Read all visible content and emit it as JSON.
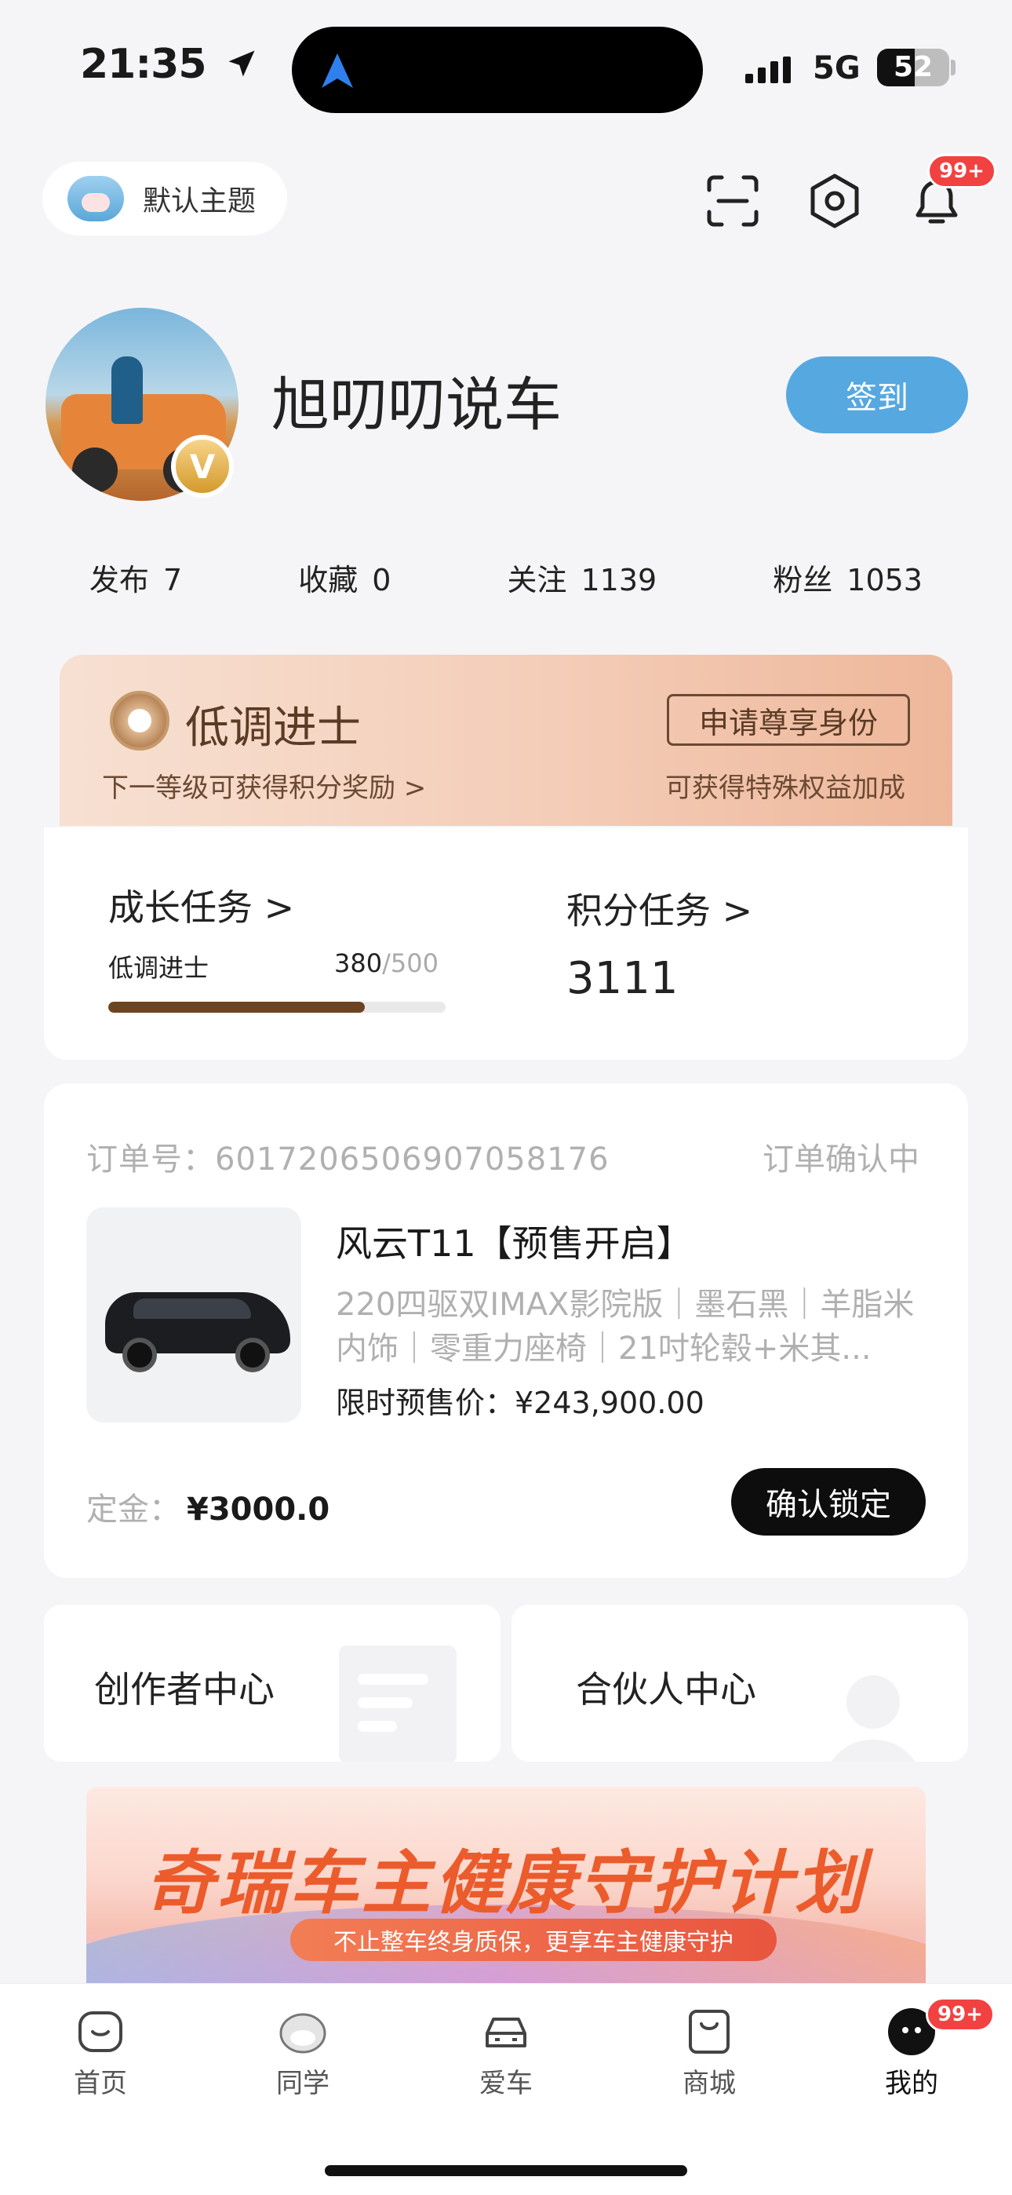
{
  "status_bar": {
    "time": "21:35",
    "network": "5G",
    "battery": "52",
    "battery_level": 0.52
  },
  "header": {
    "theme_label": "默认主题",
    "notification_badge": "99+"
  },
  "profile": {
    "username": "旭叨叨说车",
    "verified_mark": "V",
    "signin_label": "签到",
    "stats": [
      {
        "label": "发布",
        "value": "7"
      },
      {
        "label": "收藏",
        "value": "0"
      },
      {
        "label": "关注",
        "value": "1139"
      },
      {
        "label": "粉丝",
        "value": "1053"
      }
    ]
  },
  "level": {
    "title": "低调进士",
    "sub": "下一等级可获得积分奖励 >",
    "apply_label": "申请尊享身份",
    "apply_sub": "可获得特殊权益加成"
  },
  "tasks": {
    "growth_title": "成长任务 >",
    "growth_level": "低调进士",
    "growth_current": "380",
    "growth_total": "/500",
    "growth_progress": 0.76,
    "points_title": "积分任务 >",
    "points_value": "3111"
  },
  "order": {
    "number": "订单号：6017206506907058176",
    "status": "订单确认中",
    "product_title": "风云T11【预售开启】",
    "product_desc": "220四驱双IMAX影院版｜墨石黑｜羊脂米内饰｜零重力座椅｜21吋轮毂+米其...",
    "price": "限时预售价：¥243,900.00",
    "deposit_label": "定金：",
    "deposit_value": "¥3000.0",
    "confirm_label": "确认锁定"
  },
  "centers": {
    "creator": "创作者中心",
    "partner": "合伙人中心"
  },
  "banner": {
    "title": "奇瑞车主健康守护计划",
    "subtitle": "不止整车终身质保，更享车主健康守护"
  },
  "tabbar": {
    "items": [
      {
        "label": "首页"
      },
      {
        "label": "同学"
      },
      {
        "label": "爱车"
      },
      {
        "label": "商城"
      },
      {
        "label": "我的"
      }
    ],
    "badge": "99+"
  },
  "colors": {
    "accent_blue": "#56a8e0",
    "level_brown": "#6d4422",
    "badge_red": "#f24141"
  }
}
